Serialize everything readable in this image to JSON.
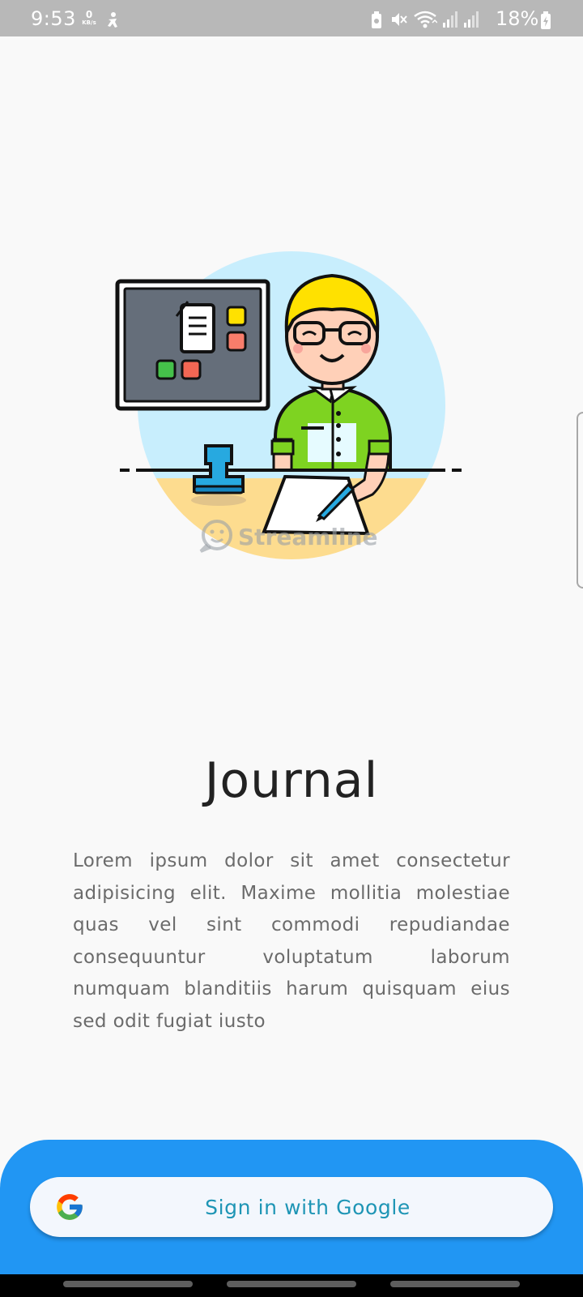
{
  "status_bar": {
    "time": "9:53",
    "net_speed_value": "0",
    "net_speed_unit": "KB/s",
    "battery_percent": "18%",
    "icons": [
      "accessibility-icon",
      "battery-saver-icon",
      "mute-icon",
      "wifi-icon",
      "signal-icon",
      "signal-icon",
      "battery-charging-icon"
    ]
  },
  "illustration": {
    "watermark": "Streamline",
    "colors": {
      "circle_top": "#c8eefd",
      "circle_bottom": "#fddc8f",
      "board": "#656e7a",
      "hair": "#ffe100",
      "shirt": "#7ed321",
      "stamp": "#27a9e0"
    }
  },
  "main": {
    "title": "Journal",
    "description": "Lorem ipsum dolor sit amet consectetur adipisicing elit. Maxime mollitia molestiae quas vel sint commodi repudiandae consequuntur voluptatum laborum numquam blanditiis harum quisquam eius sed odit fugiat iusto"
  },
  "sign_in": {
    "label": "Sign in with Google",
    "icon": "google-icon",
    "panel_color": "#2196f3"
  }
}
